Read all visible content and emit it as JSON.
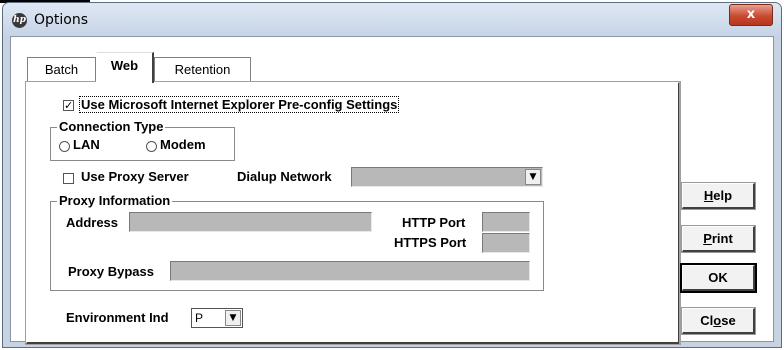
{
  "window": {
    "title": "Options",
    "close_label": "x",
    "app_icon": "hp-logo-icon"
  },
  "tabs": [
    {
      "label": "Batch",
      "active": false
    },
    {
      "label": "Web",
      "active": true
    },
    {
      "label": "Retention",
      "active": false
    }
  ],
  "web": {
    "use_ie_preconfig": {
      "label": "Use Microsoft Internet Explorer Pre-config Settings",
      "checked": true
    },
    "connection_type": {
      "title": "Connection Type",
      "options": [
        "LAN",
        "Modem"
      ],
      "selected": ""
    },
    "use_proxy": {
      "label": "Use Proxy Server",
      "checked": false
    },
    "dialup": {
      "label": "Dialup Network",
      "value": ""
    },
    "proxy_info": {
      "title": "Proxy Information",
      "address_label": "Address",
      "address_value": "",
      "http_port_label": "HTTP Port",
      "http_port_value": "",
      "https_port_label": "HTTPS Port",
      "https_port_value": "",
      "bypass_label": "Proxy Bypass",
      "bypass_value": ""
    },
    "environment": {
      "label": "Environment Ind",
      "value": "P"
    }
  },
  "buttons": {
    "help": {
      "prefix": "",
      "mnemonic": "H",
      "suffix": "elp"
    },
    "print": {
      "prefix": "",
      "mnemonic": "P",
      "suffix": "rint"
    },
    "ok": "OK",
    "close": {
      "prefix": "Cl",
      "mnemonic": "o",
      "suffix": "se"
    }
  },
  "colors": {
    "disabled_field": "#b8b8b8",
    "titlebar": "#dfe8f4",
    "close_button": "#c84a31"
  }
}
